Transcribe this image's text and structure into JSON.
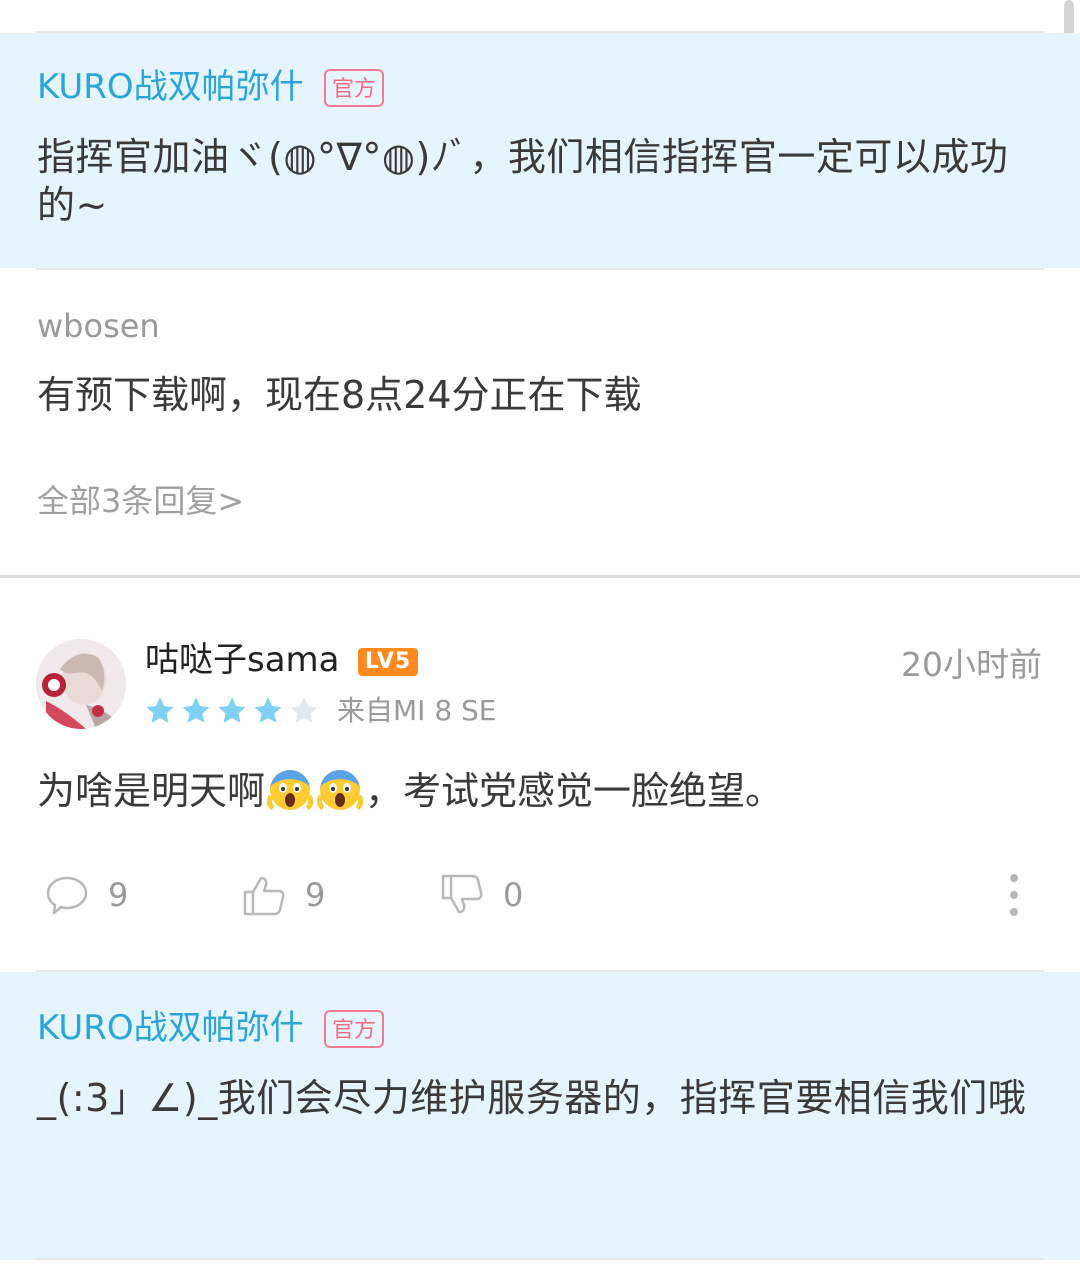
{
  "official_reply_1": {
    "name": "KURO战双帕弥什",
    "badge": "官方",
    "text": "指挥官加油ヾ(◍°∇°◍)ﾉﾞ，我们相信指挥官一定可以成功的~"
  },
  "reply": {
    "user": "wbosen",
    "text": "有预下载啊，现在8点24分正在下载",
    "more": "全部3条回复>"
  },
  "comment": {
    "username": "咕哒子sama",
    "level": "LV5",
    "time": "20小时前",
    "rating": 4,
    "rating_max": 5,
    "device": "来自MI 8 SE",
    "text_before": "为啥是明天啊",
    "text_after": "，考试党感觉一脸绝望。",
    "emoji": "screaming-face-emoji",
    "comment_count": "9",
    "like_count": "9",
    "dislike_count": "0"
  },
  "official_reply_2": {
    "name": "KURO战双帕弥什",
    "badge": "官方",
    "text": "_(:3」∠)_我们会尽力维护服务器的，指挥官要相信我们哦"
  },
  "colors": {
    "official_bg": "#e6f5fd",
    "official_name": "#2aa5dc",
    "badge": "#f27d92",
    "star_on": "#7fd0f4",
    "star_off": "#e3e8ec",
    "level_badge": "#ff8a1f"
  }
}
